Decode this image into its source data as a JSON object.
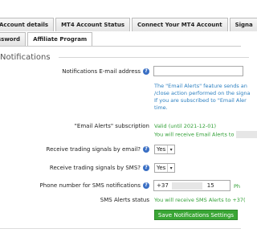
{
  "tabs_row_1": [
    {
      "label": "Account details",
      "active": false
    },
    {
      "label": "MT4 Account Status",
      "active": false
    },
    {
      "label": "Connect Your MT4 Account",
      "active": false
    },
    {
      "label": "Signa",
      "active": false
    }
  ],
  "tabs_row_2": [
    {
      "label": "ssword",
      "active": false
    },
    {
      "label": "Affiliate Program",
      "active": true
    }
  ],
  "section_title": "Notifications",
  "email_label": "Notifications E-mail address",
  "email_value": "",
  "info_lines": [
    "The \"Email Alerts\" feature sends an",
    "/close action performed on the signa",
    "If you are subscribed to \"Email Aler",
    "time."
  ],
  "subscription": {
    "label": "\"Email Alerts\" subscription",
    "status": "Valid (until 2021-12-01)",
    "note": "You will receive Email Alerts to"
  },
  "email_signals": {
    "label": "Receive trading signals by email?",
    "value": "Yes"
  },
  "sms_signals": {
    "label": "Receive trading signals by SMS?",
    "value": "Yes"
  },
  "phone": {
    "label": "Phone number for SMS notifications",
    "prefix": "+37",
    "suffix": "15",
    "trailing": "Ph"
  },
  "sms_status": {
    "label": "SMS Alerts status",
    "value": "You will receive SMS Alerts to +37("
  },
  "save_button": "Save Notifications Settings",
  "icons": {
    "help": "help-icon",
    "dropdown": "chevron-down-icon"
  }
}
